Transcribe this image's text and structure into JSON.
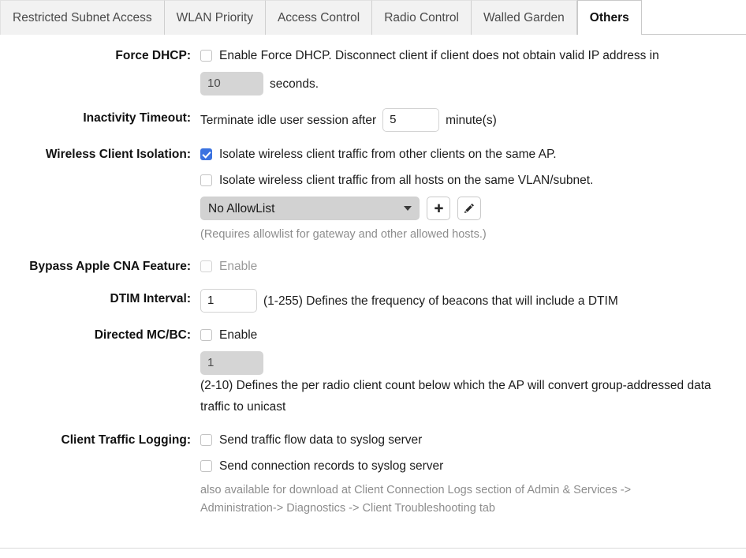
{
  "tabs": [
    {
      "label": "Restricted Subnet Access",
      "active": false
    },
    {
      "label": "WLAN Priority",
      "active": false
    },
    {
      "label": "Access Control",
      "active": false
    },
    {
      "label": "Radio Control",
      "active": false
    },
    {
      "label": "Walled Garden",
      "active": false
    },
    {
      "label": "Others",
      "active": true
    }
  ],
  "colors": {
    "checkbox_checked": "#3a72e0",
    "tab_active_bg": "#ffffff",
    "tab_inactive_bg": "#f2f2f2",
    "disabled_input_bg": "#d5d5d5",
    "select_bg": "#d2d2d2",
    "hint_text": "#8d8d8d"
  },
  "force_dhcp": {
    "label": "Force DHCP:",
    "checkbox_label": "Enable Force DHCP. Disconnect client if client does not obtain valid IP address in",
    "checked": false,
    "timeout_value": "10",
    "timeout_disabled": true,
    "unit": "seconds."
  },
  "inactivity_timeout": {
    "label": "Inactivity Timeout:",
    "prefix": "Terminate idle user session after",
    "value": "5",
    "unit": "minute(s)"
  },
  "wireless_client_isolation": {
    "label": "Wireless Client Isolation:",
    "option_ap": {
      "text": "Isolate wireless client traffic from other clients on the same AP.",
      "checked": true
    },
    "option_vlan": {
      "text": "Isolate wireless client traffic from all hosts on the same VLAN/subnet.",
      "checked": false
    },
    "allowlist_selected": "No AllowList",
    "add_button_icon": "plus-icon",
    "edit_button_icon": "pencil-icon",
    "hint": "(Requires allowlist for gateway and other allowed hosts.)"
  },
  "bypass_apple_cna": {
    "label": "Bypass Apple CNA Feature:",
    "checkbox_label": "Enable",
    "checked": false,
    "disabled": true
  },
  "dtim_interval": {
    "label": "DTIM Interval:",
    "value": "1",
    "description": "(1-255) Defines the frequency of beacons that will include a DTIM"
  },
  "directed_mcbc": {
    "label": "Directed MC/BC:",
    "checkbox_label": "Enable",
    "checked": false,
    "count_value": "1",
    "count_disabled": true,
    "description": "(2-10) Defines the per radio client count below which the AP will convert group-addressed data traffic to unicast"
  },
  "client_traffic_logging": {
    "label": "Client Traffic Logging:",
    "option_flow": {
      "text": "Send traffic flow data to syslog server",
      "checked": false
    },
    "option_connection": {
      "text": "Send connection records to syslog server",
      "checked": false
    },
    "hint": "also available for download at Client Connection Logs section of Admin & Services -> Administration-> Diagnostics -> Client Troubleshooting tab"
  }
}
